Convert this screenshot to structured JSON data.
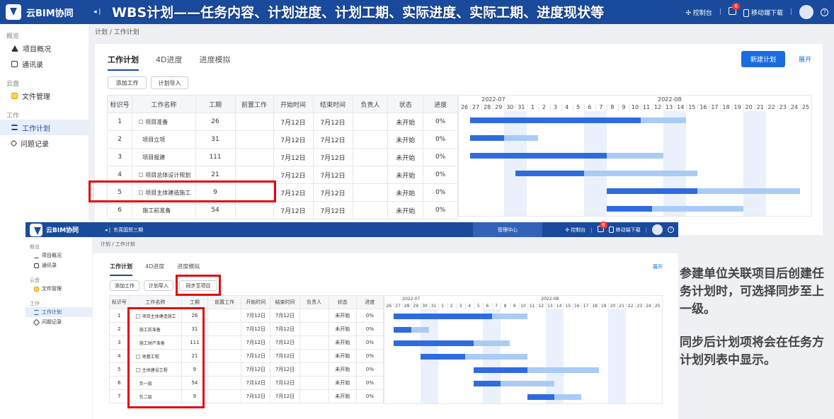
{
  "app": {
    "logo": "云BIM协同",
    "banner_title": "WBS计划——任务内容、计划进度、计划工期、实际进度、实际工期、进度现状等",
    "console": "控制台",
    "notif_count": "6",
    "mobile": "移动端下载",
    "help": "?",
    "collapse": "◂ |"
  },
  "sidebar": {
    "groups": [
      {
        "title": "概览",
        "items": [
          "项目概况",
          "通讯录"
        ]
      },
      {
        "title": "云盘",
        "items": [
          "文件管理"
        ]
      },
      {
        "title": "工作",
        "items": [
          "工作计划",
          "问题记录"
        ]
      }
    ]
  },
  "breadcrumb": "计划 / 工作计划",
  "tabs": [
    "工作计划",
    "4D进度",
    "进度模拟"
  ],
  "buttons": {
    "new_plan": "新建计划",
    "expand": "展开",
    "add_work": "添加工作",
    "import": "计划导入",
    "sync": "同步至项目"
  },
  "table": {
    "headers": [
      "标识号",
      "工作名称",
      "工期",
      "前置工作",
      "开始时间",
      "结束时间",
      "负责人",
      "状态",
      "进度"
    ],
    "rows1": [
      [
        "1",
        "项目准备",
        "26",
        "",
        "7月12日",
        "7月12日",
        "",
        "未开始",
        "0%"
      ],
      [
        "2",
        "项目立项",
        "31",
        "",
        "7月12日",
        "7月12日",
        "",
        "未开始",
        "0%"
      ],
      [
        "3",
        "项目报建",
        "111",
        "",
        "7月12日",
        "7月12日",
        "",
        "未开始",
        "0%"
      ],
      [
        "4",
        "项目总体设计规划",
        "21",
        "",
        "7月12日",
        "7月12日",
        "",
        "未开始",
        "0%"
      ],
      [
        "5",
        "项目主体建造施工",
        "9",
        "",
        "7月12日",
        "7月12日",
        "",
        "未开始",
        "0%"
      ],
      [
        "6",
        "施工前准备",
        "54",
        "",
        "7月12日",
        "7月12日",
        "",
        "未开始",
        "0%"
      ]
    ],
    "rows2": [
      [
        "1",
        "项目主体建造施工",
        "26",
        "",
        "7月12日",
        "7月12日",
        "",
        "未开始",
        "0%"
      ],
      [
        "2",
        "施工前准备",
        "31",
        "",
        "7月12日",
        "7月12日",
        "",
        "未开始",
        "0%"
      ],
      [
        "3",
        "施工财产准备",
        "111",
        "",
        "7月12日",
        "7月12日",
        "",
        "未开始",
        "0%"
      ],
      [
        "4",
        "地基工程",
        "21",
        "",
        "7月12日",
        "7月12日",
        "",
        "未开始",
        "0%"
      ],
      [
        "5",
        "主体建设工程",
        "9",
        "",
        "7月12日",
        "7月12日",
        "",
        "未开始",
        "0%"
      ],
      [
        "6",
        "负一层",
        "54",
        "",
        "7月12日",
        "7月12日",
        "",
        "未开始",
        "0%"
      ],
      [
        "7",
        "负二层",
        "9",
        "",
        "7月12日",
        "7月12日",
        "",
        "未开始",
        "0%"
      ]
    ]
  },
  "gantt": {
    "months": [
      "2022-07",
      "2022-08"
    ],
    "days": [
      "26",
      "27",
      "28",
      "29",
      "30",
      "31",
      "1",
      "2",
      "3",
      "4",
      "5",
      "6",
      "7",
      "8",
      "9",
      "10",
      "11",
      "12",
      "13",
      "14",
      "15",
      "16",
      "17",
      "18",
      "19",
      "20",
      "21",
      "22",
      "23",
      "24",
      "25"
    ],
    "weekend_idx": [
      4,
      5,
      11,
      12,
      18,
      19,
      25,
      26
    ],
    "bars1": [
      {
        "s": 1,
        "e": 16,
        "p": 1,
        "pe": 20
      },
      {
        "s": 1,
        "e": 4,
        "p": 1,
        "pe": 7
      },
      {
        "s": 1,
        "e": 13,
        "p": 1,
        "pe": 18
      },
      {
        "s": 5,
        "e": 11,
        "p": 5,
        "pe": 21
      },
      {
        "s": 13,
        "e": 21,
        "p": 13,
        "pe": 30
      },
      {
        "s": 13,
        "e": 17,
        "p": 13,
        "pe": 25
      }
    ],
    "bars2": [
      {
        "s": 1,
        "e": 12,
        "p": 1,
        "pe": 16
      },
      {
        "s": 1,
        "e": 3,
        "p": 1,
        "pe": 5
      },
      {
        "s": 1,
        "e": 10,
        "p": 1,
        "pe": 14
      },
      {
        "s": 4,
        "e": 9,
        "p": 4,
        "pe": 16
      },
      {
        "s": 10,
        "e": 16,
        "p": 10,
        "pe": 24
      },
      {
        "s": 10,
        "e": 13,
        "p": 10,
        "pe": 19
      },
      {
        "s": 16,
        "e": 19,
        "p": 16,
        "pe": 22
      }
    ]
  },
  "panel2": {
    "project": "东莞国贸三期",
    "mgmt": "管理中心"
  },
  "notes": [
    "参建单位关联项目后创建任务计划时，可选择同步至上一级。",
    "同步后计划项将会在任务方计划列表中显示。"
  ]
}
